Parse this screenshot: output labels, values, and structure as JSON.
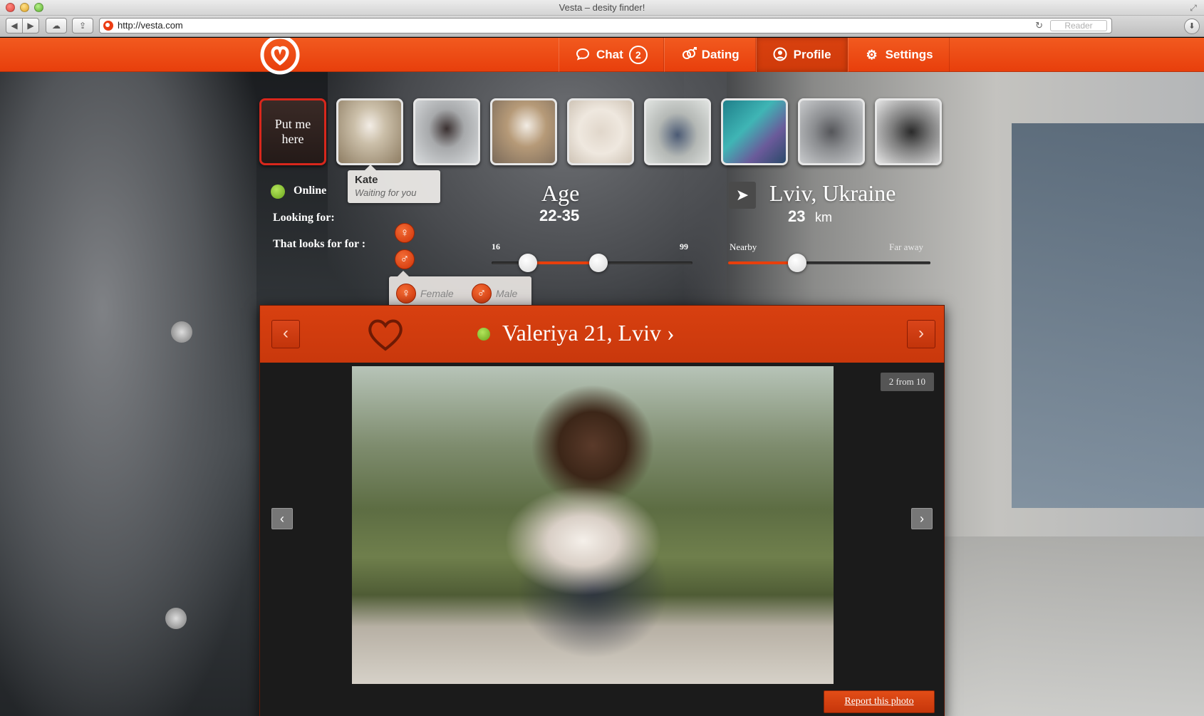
{
  "browser": {
    "window_title": "Vesta – desity finder!",
    "url": "http://vesta.com",
    "reader_label": "Reader"
  },
  "nav": {
    "chat_label": "Chat",
    "chat_badge": "2",
    "dating_label": "Dating",
    "profile_label": "Profile",
    "settings_label": "Settings",
    "active": "Profile"
  },
  "thumbnails": {
    "put_me_here": "Put me here",
    "count": 8
  },
  "tooltip": {
    "name": "Kate",
    "status": "Waiting for you"
  },
  "filters": {
    "online_label": "Online",
    "looking_for_label": "Looking for:",
    "looks_for_label": "That looks for for :",
    "looking_for_symbol": "♀",
    "looks_for_symbol": "♂",
    "popup": {
      "female_label": "Female",
      "male_label": "Male"
    },
    "age": {
      "title": "Age",
      "range": "22-35",
      "min": "16",
      "max": "99"
    },
    "location": {
      "title": "Lviv, Ukraine",
      "distance": "23",
      "unit": "km",
      "nearby_label": "Nearby",
      "faraway_label": "Far away"
    }
  },
  "profile": {
    "name": "Valeriya 21, Lviv",
    "photo_counter": "2 from 10",
    "report_label": "Report this photo"
  },
  "colors": {
    "brand_orange": "#e83f0c",
    "online_green": "#6aa41b"
  }
}
